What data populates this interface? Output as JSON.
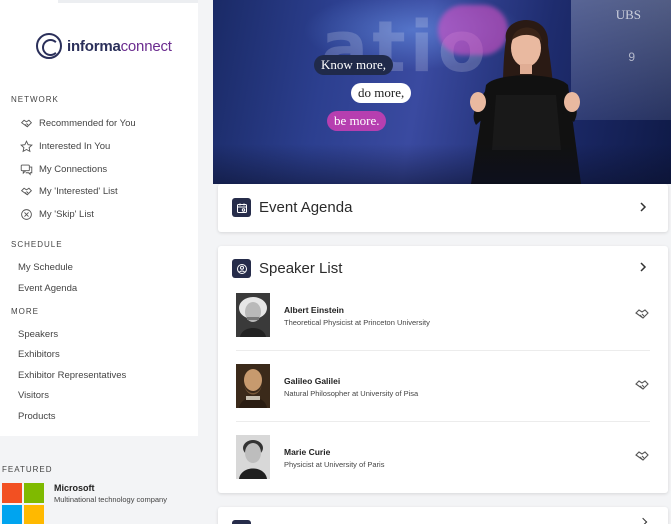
{
  "logo": {
    "brand": "informa",
    "suffix": "connect"
  },
  "sidebar": {
    "network_label": "NETWORK",
    "network_items": [
      {
        "label": "Recommended for You",
        "icon": "handshake-icon"
      },
      {
        "label": "Interested In You",
        "icon": "star-icon"
      },
      {
        "label": "My Connections",
        "icon": "chat-icon"
      },
      {
        "label": "My 'Interested' List",
        "icon": "handshake-icon"
      },
      {
        "label": "My 'Skip' List",
        "icon": "close-circle-icon"
      }
    ],
    "schedule_label": "SCHEDULE",
    "schedule_items": [
      "My Schedule",
      "Event Agenda"
    ],
    "more_label": "MORE",
    "more_items": [
      "Speakers",
      "Exhibitors",
      "Exhibitor Representatives",
      "Visitors",
      "Products"
    ]
  },
  "featured": {
    "label": "FEATURED",
    "name": "Microsoft",
    "description": "Multinational technology company",
    "logo_colors": [
      "#f25022",
      "#7fba00",
      "#00a4ef",
      "#ffb900"
    ]
  },
  "hero": {
    "line1": "Know more,",
    "line2": "do more,",
    "line3": "be more.",
    "backdrop_text": "atio",
    "sign_text": "UBS",
    "sign_num": "9"
  },
  "agenda_card": {
    "title": "Event Agenda"
  },
  "speaker_card": {
    "title": "Speaker List",
    "speakers": [
      {
        "name": "Albert Einstein",
        "description": "Theoretical Physicist at Princeton University"
      },
      {
        "name": "Galileo Galilei",
        "description": "Natural Philosopher at University of Pisa"
      },
      {
        "name": "Marie Curie",
        "description": "Physicist at University of Paris"
      }
    ]
  },
  "colors": {
    "accent_purple": "#6b2c8f",
    "navy": "#262c4a",
    "pink_pill": "#b63fb0"
  }
}
